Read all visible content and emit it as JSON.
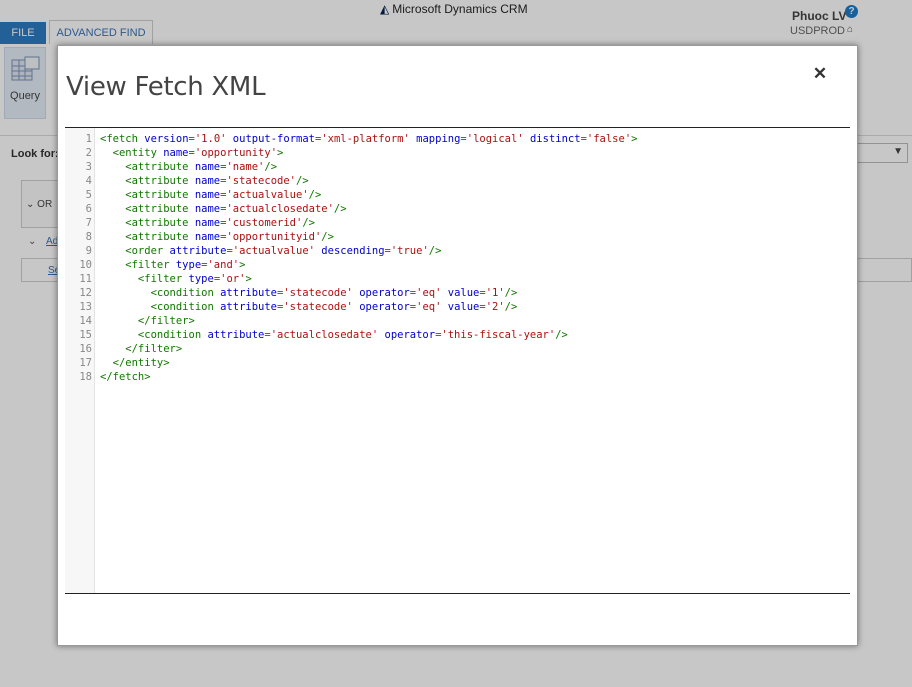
{
  "app": {
    "brand": "Microsoft Dynamics CRM",
    "user_name": "Phuoc LV",
    "help_glyph": "?",
    "org_name": "USDPROD",
    "tabs": {
      "file": "FILE",
      "advanced_find": "ADVANCED FIND"
    },
    "ribbon": {
      "query_label": "Query"
    },
    "look_for_label": "Look for:",
    "group_text": "OR",
    "row_link": "Ad",
    "select_link": "Se"
  },
  "dialog": {
    "title": "View Fetch XML",
    "close_glyph": "✕",
    "code_lines": [
      [
        [
          "tag",
          "<fetch "
        ],
        [
          "attr",
          "version"
        ],
        [
          "tag",
          "="
        ],
        [
          "str",
          "'1.0'"
        ],
        [
          "tag",
          " "
        ],
        [
          "attr",
          "output-format"
        ],
        [
          "tag",
          "="
        ],
        [
          "str",
          "'xml-platform'"
        ],
        [
          "tag",
          " "
        ],
        [
          "attr",
          "mapping"
        ],
        [
          "tag",
          "="
        ],
        [
          "str",
          "'logical'"
        ],
        [
          "tag",
          " "
        ],
        [
          "attr",
          "distinct"
        ],
        [
          "tag",
          "="
        ],
        [
          "str",
          "'false'"
        ],
        [
          "tag",
          ">"
        ]
      ],
      [
        [
          "tag",
          "  <entity "
        ],
        [
          "attr",
          "name"
        ],
        [
          "tag",
          "="
        ],
        [
          "str",
          "'opportunity'"
        ],
        [
          "tag",
          ">"
        ]
      ],
      [
        [
          "tag",
          "    <attribute "
        ],
        [
          "attr",
          "name"
        ],
        [
          "tag",
          "="
        ],
        [
          "str",
          "'name'"
        ],
        [
          "tag",
          "/>"
        ]
      ],
      [
        [
          "tag",
          "    <attribute "
        ],
        [
          "attr",
          "name"
        ],
        [
          "tag",
          "="
        ],
        [
          "str",
          "'statecode'"
        ],
        [
          "tag",
          "/>"
        ]
      ],
      [
        [
          "tag",
          "    <attribute "
        ],
        [
          "attr",
          "name"
        ],
        [
          "tag",
          "="
        ],
        [
          "str",
          "'actualvalue'"
        ],
        [
          "tag",
          "/>"
        ]
      ],
      [
        [
          "tag",
          "    <attribute "
        ],
        [
          "attr",
          "name"
        ],
        [
          "tag",
          "="
        ],
        [
          "str",
          "'actualclosedate'"
        ],
        [
          "tag",
          "/>"
        ]
      ],
      [
        [
          "tag",
          "    <attribute "
        ],
        [
          "attr",
          "name"
        ],
        [
          "tag",
          "="
        ],
        [
          "str",
          "'customerid'"
        ],
        [
          "tag",
          "/>"
        ]
      ],
      [
        [
          "tag",
          "    <attribute "
        ],
        [
          "attr",
          "name"
        ],
        [
          "tag",
          "="
        ],
        [
          "str",
          "'opportunityid'"
        ],
        [
          "tag",
          "/>"
        ]
      ],
      [
        [
          "tag",
          "    <order "
        ],
        [
          "attr",
          "attribute"
        ],
        [
          "tag",
          "="
        ],
        [
          "str",
          "'actualvalue'"
        ],
        [
          "tag",
          " "
        ],
        [
          "attr",
          "descending"
        ],
        [
          "tag",
          "="
        ],
        [
          "str",
          "'true'"
        ],
        [
          "tag",
          "/>"
        ]
      ],
      [
        [
          "tag",
          "    <filter "
        ],
        [
          "attr",
          "type"
        ],
        [
          "tag",
          "="
        ],
        [
          "str",
          "'and'"
        ],
        [
          "tag",
          ">"
        ]
      ],
      [
        [
          "tag",
          "      <filter "
        ],
        [
          "attr",
          "type"
        ],
        [
          "tag",
          "="
        ],
        [
          "str",
          "'or'"
        ],
        [
          "tag",
          ">"
        ]
      ],
      [
        [
          "tag",
          "        <condition "
        ],
        [
          "attr",
          "attribute"
        ],
        [
          "tag",
          "="
        ],
        [
          "str",
          "'statecode'"
        ],
        [
          "tag",
          " "
        ],
        [
          "attr",
          "operator"
        ],
        [
          "tag",
          "="
        ],
        [
          "str",
          "'eq'"
        ],
        [
          "tag",
          " "
        ],
        [
          "attr",
          "value"
        ],
        [
          "tag",
          "="
        ],
        [
          "str",
          "'1'"
        ],
        [
          "tag",
          "/>"
        ]
      ],
      [
        [
          "tag",
          "        <condition "
        ],
        [
          "attr",
          "attribute"
        ],
        [
          "tag",
          "="
        ],
        [
          "str",
          "'statecode'"
        ],
        [
          "tag",
          " "
        ],
        [
          "attr",
          "operator"
        ],
        [
          "tag",
          "="
        ],
        [
          "str",
          "'eq'"
        ],
        [
          "tag",
          " "
        ],
        [
          "attr",
          "value"
        ],
        [
          "tag",
          "="
        ],
        [
          "str",
          "'2'"
        ],
        [
          "tag",
          "/>"
        ]
      ],
      [
        [
          "tag",
          "      </filter>"
        ]
      ],
      [
        [
          "tag",
          "      <condition "
        ],
        [
          "attr",
          "attribute"
        ],
        [
          "tag",
          "="
        ],
        [
          "str",
          "'actualclosedate'"
        ],
        [
          "tag",
          " "
        ],
        [
          "attr",
          "operator"
        ],
        [
          "tag",
          "="
        ],
        [
          "str",
          "'this-fiscal-year'"
        ],
        [
          "tag",
          "/>"
        ]
      ],
      [
        [
          "tag",
          "    </filter>"
        ]
      ],
      [
        [
          "tag",
          "  </entity>"
        ]
      ],
      [
        [
          "tag",
          "</fetch>"
        ]
      ]
    ],
    "line_numbers": [
      "1",
      "2",
      "3",
      "4",
      "5",
      "6",
      "7",
      "8",
      "9",
      "10",
      "11",
      "12",
      "13",
      "14",
      "15",
      "16",
      "17",
      "18"
    ]
  }
}
